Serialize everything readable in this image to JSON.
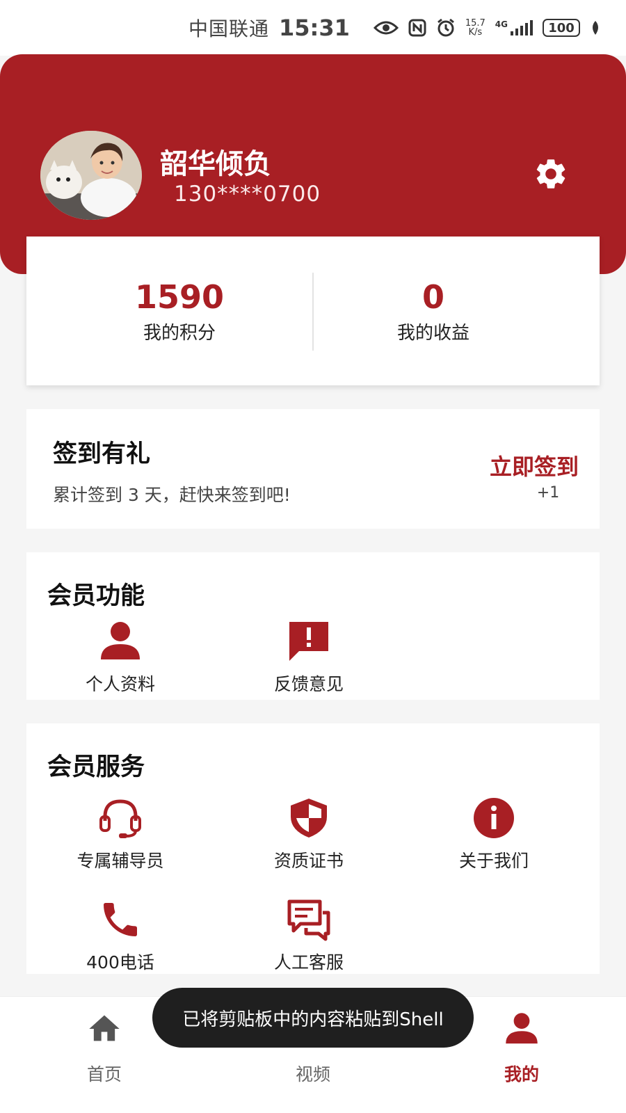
{
  "status_bar": {
    "carrier": "中国联通",
    "time": "15:31",
    "network_speed_value": "15.7",
    "network_speed_unit": "K/s",
    "network_type": "4G",
    "battery": "100"
  },
  "profile": {
    "name": "韶华倾负",
    "phone": "130****0700"
  },
  "stats": [
    {
      "value": "1590",
      "label": "我的积分"
    },
    {
      "value": "0",
      "label": "我的收益"
    }
  ],
  "checkin": {
    "title": "签到有礼",
    "description": "累计签到 3 天，赶快来签到吧!",
    "button": "立即签到",
    "bonus": "+1"
  },
  "member_functions": {
    "title": "会员功能",
    "items": [
      {
        "label": "个人资料",
        "icon": "person-icon"
      },
      {
        "label": "反馈意见",
        "icon": "feedback-icon"
      }
    ]
  },
  "member_services": {
    "title": "会员服务",
    "items": [
      {
        "label": "专属辅导员",
        "icon": "headset-icon"
      },
      {
        "label": "资质证书",
        "icon": "shield-icon"
      },
      {
        "label": "关于我们",
        "icon": "info-icon"
      },
      {
        "label": "400电话",
        "icon": "phone-icon"
      },
      {
        "label": "人工客服",
        "icon": "chat-icon"
      }
    ]
  },
  "bottom_nav": {
    "items": [
      {
        "label": "首页",
        "icon": "home-icon",
        "active": false
      },
      {
        "label": "视频",
        "icon": "video-icon",
        "active": false
      },
      {
        "label": "我的",
        "icon": "person-icon",
        "active": true
      }
    ]
  },
  "toast": "已将剪贴板中的内容粘贴到Shell",
  "colors": {
    "brand": "#a81f24",
    "background": "#f5f5f5",
    "card": "#ffffff",
    "toast_bg": "#1f1f1f"
  }
}
